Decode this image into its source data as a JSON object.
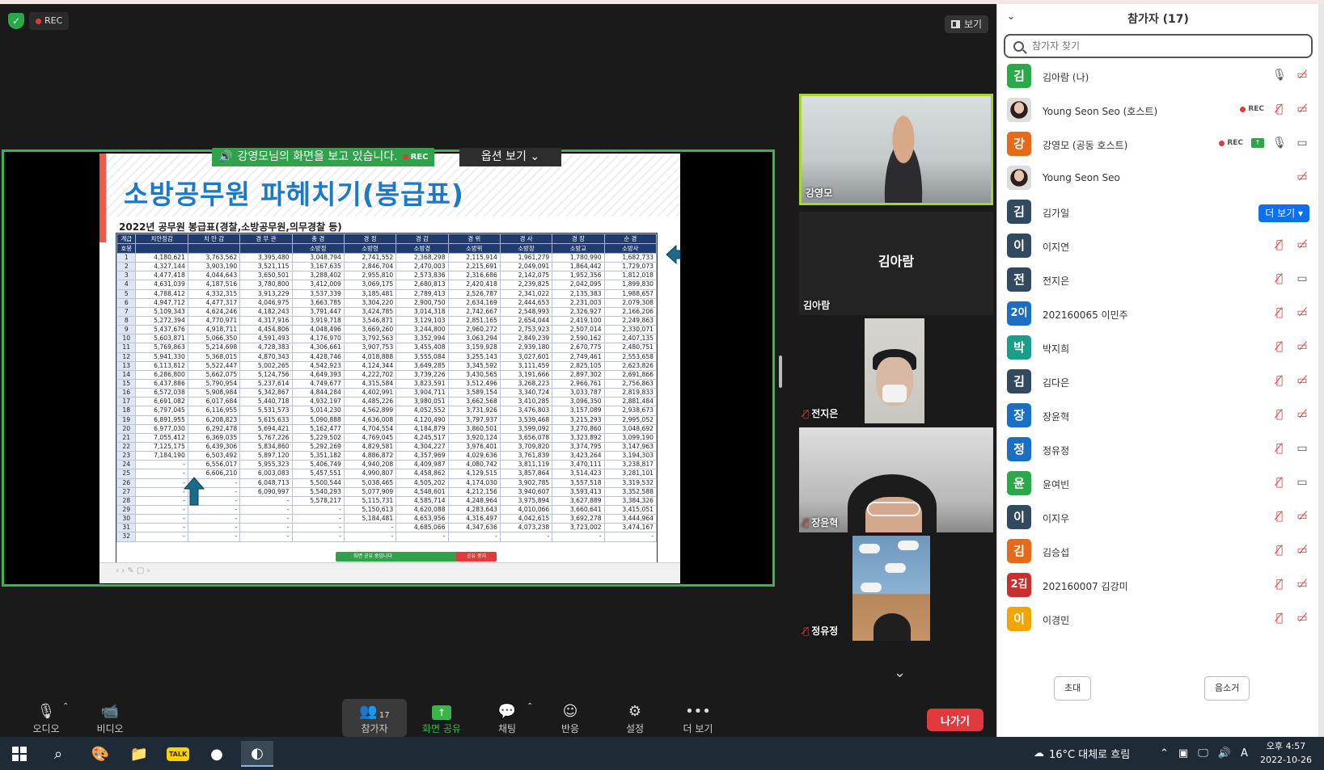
{
  "top": {
    "rec_label": "REC",
    "view_label": "보기"
  },
  "share": {
    "banner_text": "강영모님의 화면을 보고 있습니다.",
    "banner_rec": "REC",
    "options_label": "옵션 보기",
    "mini_bar_text": "화면 공유 중입니다",
    "mini_stop_text": "공유 중지"
  },
  "slide": {
    "title": "소방공무원 파헤치기(봉급표)",
    "subtitle": "2022년 공무원 봉급표(경찰,소방공무원,의무경찰 등)",
    "header_row1": [
      "계급",
      "치안정감",
      "치 안 감",
      "경 무 관",
      "총 경",
      "경 정",
      "경 감",
      "경 위",
      "경 사",
      "경 장",
      "순 경"
    ],
    "header_row2": [
      "호봉",
      "",
      "",
      "",
      "소방정",
      "소방령",
      "소방경",
      "소방위",
      "소방장",
      "소방교",
      "소방사"
    ],
    "rows": [
      [
        "1",
        "4,180,621",
        "3,763,562",
        "3,395,480",
        "3,048,794",
        "2,741,552",
        "2,368,298",
        "2,115,914",
        "1,961,279",
        "1,780,990",
        "1,682,733"
      ],
      [
        "2",
        "4,327,144",
        "3,903,190",
        "3,521,115",
        "3,167,635",
        "2,846,704",
        "2,470,003",
        "2,215,691",
        "2,049,091",
        "1,864,442",
        "1,729,073"
      ],
      [
        "3",
        "4,477,418",
        "4,044,643",
        "3,650,501",
        "3,288,402",
        "2,955,810",
        "2,573,836",
        "2,316,686",
        "2,142,075",
        "1,952,356",
        "1,812,018"
      ],
      [
        "4",
        "4,631,039",
        "4,187,516",
        "3,780,800",
        "3,412,009",
        "3,069,175",
        "2,680,813",
        "2,420,418",
        "2,239,825",
        "2,042,095",
        "1,899,830"
      ],
      [
        "5",
        "4,788,412",
        "4,332,315",
        "3,913,229",
        "3,537,339",
        "3,185,481",
        "2,789,413",
        "2,526,787",
        "2,341,022",
        "2,135,383",
        "1,988,657"
      ],
      [
        "6",
        "4,947,712",
        "4,477,317",
        "4,046,975",
        "3,663,785",
        "3,304,220",
        "2,900,750",
        "2,634,169",
        "2,444,653",
        "2,231,003",
        "2,079,308"
      ],
      [
        "7",
        "5,109,343",
        "4,624,246",
        "4,182,243",
        "3,791,447",
        "3,424,785",
        "3,014,318",
        "2,742,667",
        "2,548,993",
        "2,326,927",
        "2,166,206"
      ],
      [
        "8",
        "5,272,394",
        "4,770,971",
        "4,317,916",
        "3,919,718",
        "3,546,871",
        "3,129,103",
        "2,851,165",
        "2,654,044",
        "2,419,100",
        "2,249,863"
      ],
      [
        "9",
        "5,437,676",
        "4,918,711",
        "4,454,806",
        "4,048,496",
        "3,669,260",
        "3,244,800",
        "2,960,272",
        "2,753,923",
        "2,507,014",
        "2,330,071"
      ],
      [
        "10",
        "5,603,871",
        "5,066,350",
        "4,591,493",
        "4,176,970",
        "3,792,563",
        "3,352,994",
        "3,063,294",
        "2,849,239",
        "2,590,162",
        "2,407,135"
      ],
      [
        "11",
        "5,769,863",
        "5,214,698",
        "4,728,383",
        "4,306,661",
        "3,907,753",
        "3,455,408",
        "3,159,928",
        "2,939,180",
        "2,670,775",
        "2,480,751"
      ],
      [
        "12",
        "5,941,330",
        "5,368,015",
        "4,870,343",
        "4,428,746",
        "4,018,888",
        "3,555,084",
        "3,255,143",
        "3,027,601",
        "2,749,461",
        "2,553,658"
      ],
      [
        "13",
        "6,113,812",
        "5,522,447",
        "5,002,265",
        "4,542,923",
        "4,124,344",
        "3,649,285",
        "3,345,592",
        "3,111,459",
        "2,825,105",
        "2,623,826"
      ],
      [
        "14",
        "6,286,800",
        "5,662,075",
        "5,124,756",
        "4,649,393",
        "4,222,702",
        "3,739,226",
        "3,430,565",
        "3,191,666",
        "2,897,302",
        "2,691,866"
      ],
      [
        "15",
        "6,437,886",
        "5,790,954",
        "5,237,614",
        "4,749,677",
        "4,315,584",
        "3,823,591",
        "3,512,496",
        "3,268,223",
        "2,966,761",
        "2,756,863"
      ],
      [
        "16",
        "6,572,038",
        "5,908,984",
        "5,342,867",
        "4,844,284",
        "4,402,991",
        "3,904,711",
        "3,589,154",
        "3,340,724",
        "3,033,787",
        "2,819,833"
      ],
      [
        "17",
        "6,691,082",
        "6,017,684",
        "5,440,718",
        "4,932,197",
        "4,485,226",
        "3,980,051",
        "3,662,568",
        "3,410,285",
        "3,096,350",
        "2,881,484"
      ],
      [
        "18",
        "6,797,045",
        "6,116,955",
        "5,531,573",
        "5,014,230",
        "4,562,899",
        "4,052,552",
        "3,731,926",
        "3,476,803",
        "3,157,089",
        "2,938,673"
      ],
      [
        "19",
        "6,891,955",
        "6,208,823",
        "5,615,633",
        "5,090,888",
        "4,636,008",
        "4,120,490",
        "3,797,937",
        "3,539,468",
        "3,215,293",
        "2,995,052"
      ],
      [
        "20",
        "6,977,030",
        "6,292,478",
        "5,694,421",
        "5,162,477",
        "4,704,554",
        "4,184,879",
        "3,860,501",
        "3,599,092",
        "3,270,860",
        "3,048,692"
      ],
      [
        "21",
        "7,055,412",
        "6,369,035",
        "5,767,226",
        "5,229,502",
        "4,769,045",
        "4,245,517",
        "3,920,124",
        "3,656,078",
        "3,323,892",
        "3,099,190"
      ],
      [
        "22",
        "7,125,175",
        "6,439,306",
        "5,834,860",
        "5,292,269",
        "4,829,581",
        "4,304,227",
        "3,976,401",
        "3,709,820",
        "3,374,795",
        "3,147,963"
      ],
      [
        "23",
        "7,184,190",
        "6,503,492",
        "5,897,120",
        "5,351,182",
        "4,886,872",
        "4,357,969",
        "4,029,636",
        "3,761,839",
        "3,423,264",
        "3,194,303"
      ],
      [
        "24",
        "-",
        "6,556,017",
        "5,955,323",
        "5,406,749",
        "4,940,208",
        "4,409,987",
        "4,080,742",
        "3,811,119",
        "3,470,111",
        "3,238,817"
      ],
      [
        "25",
        "-",
        "6,606,210",
        "6,003,083",
        "5,457,551",
        "4,990,807",
        "4,458,862",
        "4,129,515",
        "3,857,864",
        "3,514,423",
        "3,281,101"
      ],
      [
        "26",
        "-",
        "-",
        "6,048,713",
        "5,500,544",
        "5,038,465",
        "4,505,202",
        "4,174,030",
        "3,902,785",
        "3,557,518",
        "3,319,532"
      ],
      [
        "27",
        "-",
        "-",
        "6,090,997",
        "5,540,293",
        "5,077,909",
        "4,548,601",
        "4,212,156",
        "3,940,607",
        "3,593,413",
        "3,352,588"
      ],
      [
        "28",
        "-",
        "-",
        "-",
        "5,578,217",
        "5,115,731",
        "4,585,714",
        "4,248,964",
        "3,975,894",
        "3,627,889",
        "3,384,326"
      ],
      [
        "29",
        "-",
        "-",
        "-",
        "-",
        "5,150,613",
        "4,620,088",
        "4,283,643",
        "4,010,066",
        "3,660,641",
        "3,415,051"
      ],
      [
        "30",
        "-",
        "-",
        "-",
        "-",
        "5,184,481",
        "4,653,956",
        "4,316,497",
        "4,042,615",
        "3,692,278",
        "3,444,964"
      ],
      [
        "31",
        "-",
        "-",
        "-",
        "-",
        "-",
        "4,685,066",
        "4,347,636",
        "4,073,238",
        "3,723,002",
        "3,474,167"
      ],
      [
        "32",
        "-",
        "-",
        "-",
        "-",
        "-",
        "-",
        "-",
        "-",
        "-",
        "-"
      ]
    ]
  },
  "gallery": {
    "tile1_name": "강영모",
    "tile2_bigname": "김아람",
    "tile2_name": "김아람",
    "tile3_name": "전지은",
    "tile4_name": "장윤혁",
    "tile5_name": "정유정"
  },
  "toolbar": {
    "audio": "오디오",
    "video": "비디오",
    "participants": "참가자",
    "participants_count": "17",
    "share": "화면 공유",
    "chat": "채팅",
    "reactions": "반응",
    "settings": "설정",
    "more": "더 보기",
    "leave": "나가기"
  },
  "panel": {
    "title": "참가자 (17)",
    "search_placeholder": "참가자 찾기",
    "rec_label": "REC",
    "more_btn": "더 보기",
    "invite": "초대",
    "remove": "음소거",
    "participants": [
      {
        "name": "김아람 (나)",
        "initial": "김",
        "color": "#2aa84a",
        "icons": [
          "mic",
          "video-off"
        ]
      },
      {
        "name": "Young Seon Seo (호스트)",
        "initial": "",
        "color": "",
        "photo": true,
        "icons": [
          "rec",
          "mic-off",
          "video-off"
        ]
      },
      {
        "name": "강영모 (공동 호스트)",
        "initial": "강",
        "color": "#e56a1a",
        "icons": [
          "rec",
          "share",
          "mic",
          "video"
        ]
      },
      {
        "name": "Young Seon Seo",
        "initial": "",
        "color": "",
        "photo": true,
        "icons": [
          "video-off"
        ]
      },
      {
        "name": "김가일",
        "initial": "김",
        "color": "#324a5f",
        "icons": [
          "more"
        ]
      },
      {
        "name": "이지연",
        "initial": "이",
        "color": "#324a5f",
        "icons": [
          "mic-off",
          "video-off"
        ]
      },
      {
        "name": "전지은",
        "initial": "전",
        "color": "#324a5f",
        "icons": [
          "mic-off",
          "video"
        ]
      },
      {
        "name": "202160065 이민주",
        "initial": "2이",
        "color": "#1a6fc4",
        "icons": [
          "mic-off",
          "video-off"
        ]
      },
      {
        "name": "박지희",
        "initial": "박",
        "color": "#1a9e8a",
        "icons": [
          "mic-off",
          "video-off"
        ]
      },
      {
        "name": "김다은",
        "initial": "김",
        "color": "#324a5f",
        "icons": [
          "mic-off",
          "video-off"
        ]
      },
      {
        "name": "장윤혁",
        "initial": "장",
        "color": "#1a6fc4",
        "icons": [
          "mic-off",
          "video-off"
        ]
      },
      {
        "name": "정유정",
        "initial": "정",
        "color": "#1a6fc4",
        "icons": [
          "mic-off",
          "video"
        ]
      },
      {
        "name": "윤여빈",
        "initial": "윤",
        "color": "#2aa84a",
        "icons": [
          "mic-off",
          "video"
        ]
      },
      {
        "name": "이지우",
        "initial": "이",
        "color": "#324a5f",
        "icons": [
          "mic-off",
          "video-off"
        ]
      },
      {
        "name": "김승섭",
        "initial": "김",
        "color": "#e56a1a",
        "icons": [
          "mic-off",
          "video-off"
        ]
      },
      {
        "name": "202160007 김강미",
        "initial": "2김",
        "color": "#c7302d",
        "icons": [
          "mic-off",
          "video-off"
        ]
      },
      {
        "name": "이경민",
        "initial": "이",
        "color": "#f0a500",
        "icons": [
          "mic-off",
          "video-off"
        ]
      }
    ]
  },
  "taskbar": {
    "weather": "16°C  대체로 흐림",
    "time": "오후 4:57",
    "date": "2022-10-26",
    "ime": "A"
  }
}
